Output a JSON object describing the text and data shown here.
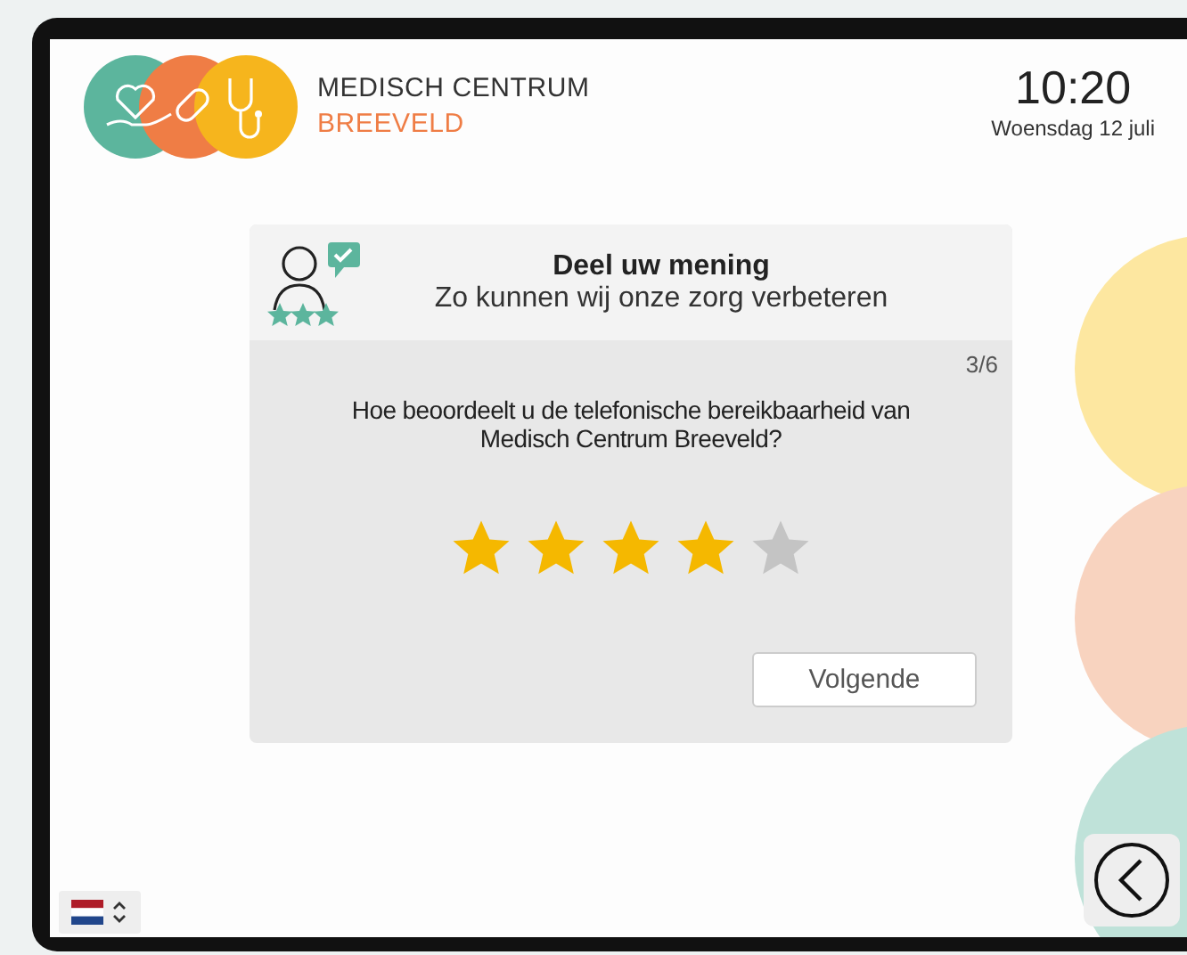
{
  "header": {
    "brand_line_1": "MEDISCH CENTRUM",
    "brand_line_2": "BREEVELD",
    "time": "10:20",
    "date": "Woensdag 12 juli"
  },
  "survey": {
    "title": "Deel uw mening",
    "subtitle": "Zo kunnen wij onze zorg verbeteren",
    "counter": "3/6",
    "question": "Hoe beoordeelt u de telefonische bereikbaarheid van Medisch Centrum Breeveld?",
    "rating": {
      "stars": 4
    },
    "next_button": "Volgende"
  }
}
